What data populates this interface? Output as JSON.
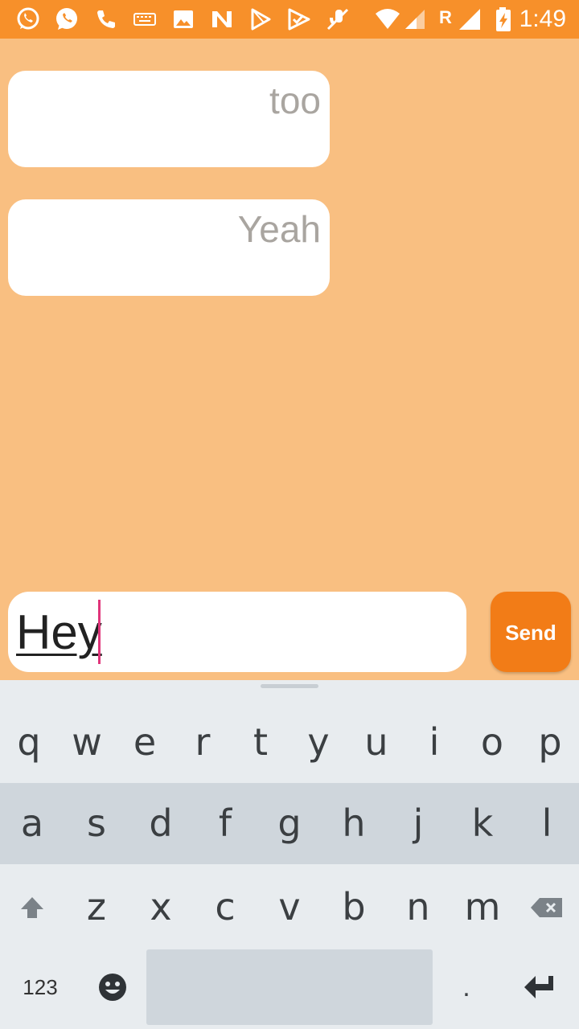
{
  "status_bar": {
    "time": "1:49",
    "roaming": "R",
    "icons": [
      "whatsapp-icon",
      "whatsapp-icon",
      "phone-icon",
      "keyboard-icon",
      "image-icon",
      "n-logo-icon",
      "play-store-icon",
      "check-icon",
      "no-mic-icon",
      "wifi-icon",
      "signal-icon",
      "signal-icon",
      "battery-charging-icon"
    ]
  },
  "messages": [
    {
      "text": "too"
    },
    {
      "text": "Yeah"
    }
  ],
  "composer": {
    "value": "Hey",
    "send_label": "Send"
  },
  "keyboard": {
    "row1": [
      "q",
      "w",
      "e",
      "r",
      "t",
      "y",
      "u",
      "i",
      "o",
      "p"
    ],
    "row2": [
      "a",
      "s",
      "d",
      "f",
      "g",
      "h",
      "j",
      "k",
      "l"
    ],
    "row3": [
      "z",
      "x",
      "c",
      "v",
      "b",
      "n",
      "m"
    ],
    "numbers_label": "123",
    "period": "."
  },
  "colors": {
    "status_bar": "#f7902a",
    "background": "#f9bf81",
    "send_button": "#f27c17",
    "caret": "#e0357a"
  }
}
